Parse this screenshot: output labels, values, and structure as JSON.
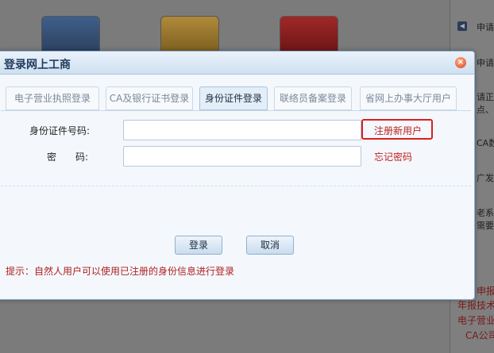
{
  "dialog": {
    "title": "登录网上工商",
    "tabs": [
      {
        "label": "电子营业执照登录",
        "active": false
      },
      {
        "label": "CA及银行证书登录",
        "active": false
      },
      {
        "label": "身份证件登录",
        "active": true
      },
      {
        "label": "联络员备案登录",
        "active": false
      },
      {
        "label": "省网上办事大厅用户",
        "active": false
      }
    ],
    "id_label": "身份证件号码:",
    "password_label": "密　　码:",
    "id_value": "",
    "password_value": "",
    "register_link": "注册新用户",
    "forgot_link": "忘记密码",
    "login_button": "登录",
    "cancel_button": "取消",
    "hint": "提示：自然人用户可以使用已注册的身份信息进行登录"
  },
  "background": {
    "sidebar": [
      "申请",
      "申请",
      "请正\n点、",
      "CA数",
      "广发",
      "老系\n需要"
    ],
    "bottom_lines": [
      "申报",
      "年报技术",
      "电子营业",
      "CA公司"
    ]
  },
  "colors": {
    "accent_red": "#c0211f",
    "header_blue": "#1f3b5c"
  }
}
